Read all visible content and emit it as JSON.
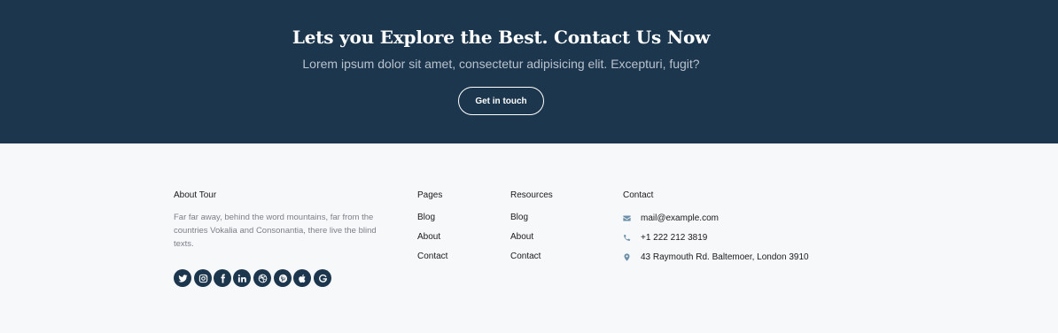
{
  "cta": {
    "title": "Lets you Explore the Best. Contact Us Now",
    "subtitle": "Lorem ipsum dolor sit amet, consectetur adipisicing elit. Excepturi, fugit?",
    "button_label": "Get in touch"
  },
  "footer": {
    "about": {
      "title": "About Tour",
      "text": "Far far away, behind the word mountains, far from the countries Vokalia and Consonantia, there live the blind texts."
    },
    "social_icons": [
      "twitter-icon",
      "instagram-icon",
      "facebook-icon",
      "linkedin-icon",
      "dribbble-icon",
      "pinterest-icon",
      "apple-icon",
      "google-icon"
    ],
    "pages": {
      "title": "Pages",
      "links": [
        "Blog",
        "About",
        "Contact"
      ]
    },
    "resources": {
      "title": "Resources",
      "links": [
        "Blog",
        "About",
        "Contact"
      ]
    },
    "contact": {
      "title": "Contact",
      "items": [
        {
          "icon": "envelope-icon",
          "text": "mail@example.com"
        },
        {
          "icon": "phone-icon",
          "text": "+1 222 212 3819"
        },
        {
          "icon": "map-marker-icon",
          "text": "43 Raymouth Rd. Baltemoer, London 3910"
        }
      ]
    }
  },
  "colors": {
    "cta_background": "#1c364d",
    "footer_background": "#f7f8fa",
    "social_background": "#1c364d",
    "contact_icon": "#6b8fa8"
  }
}
